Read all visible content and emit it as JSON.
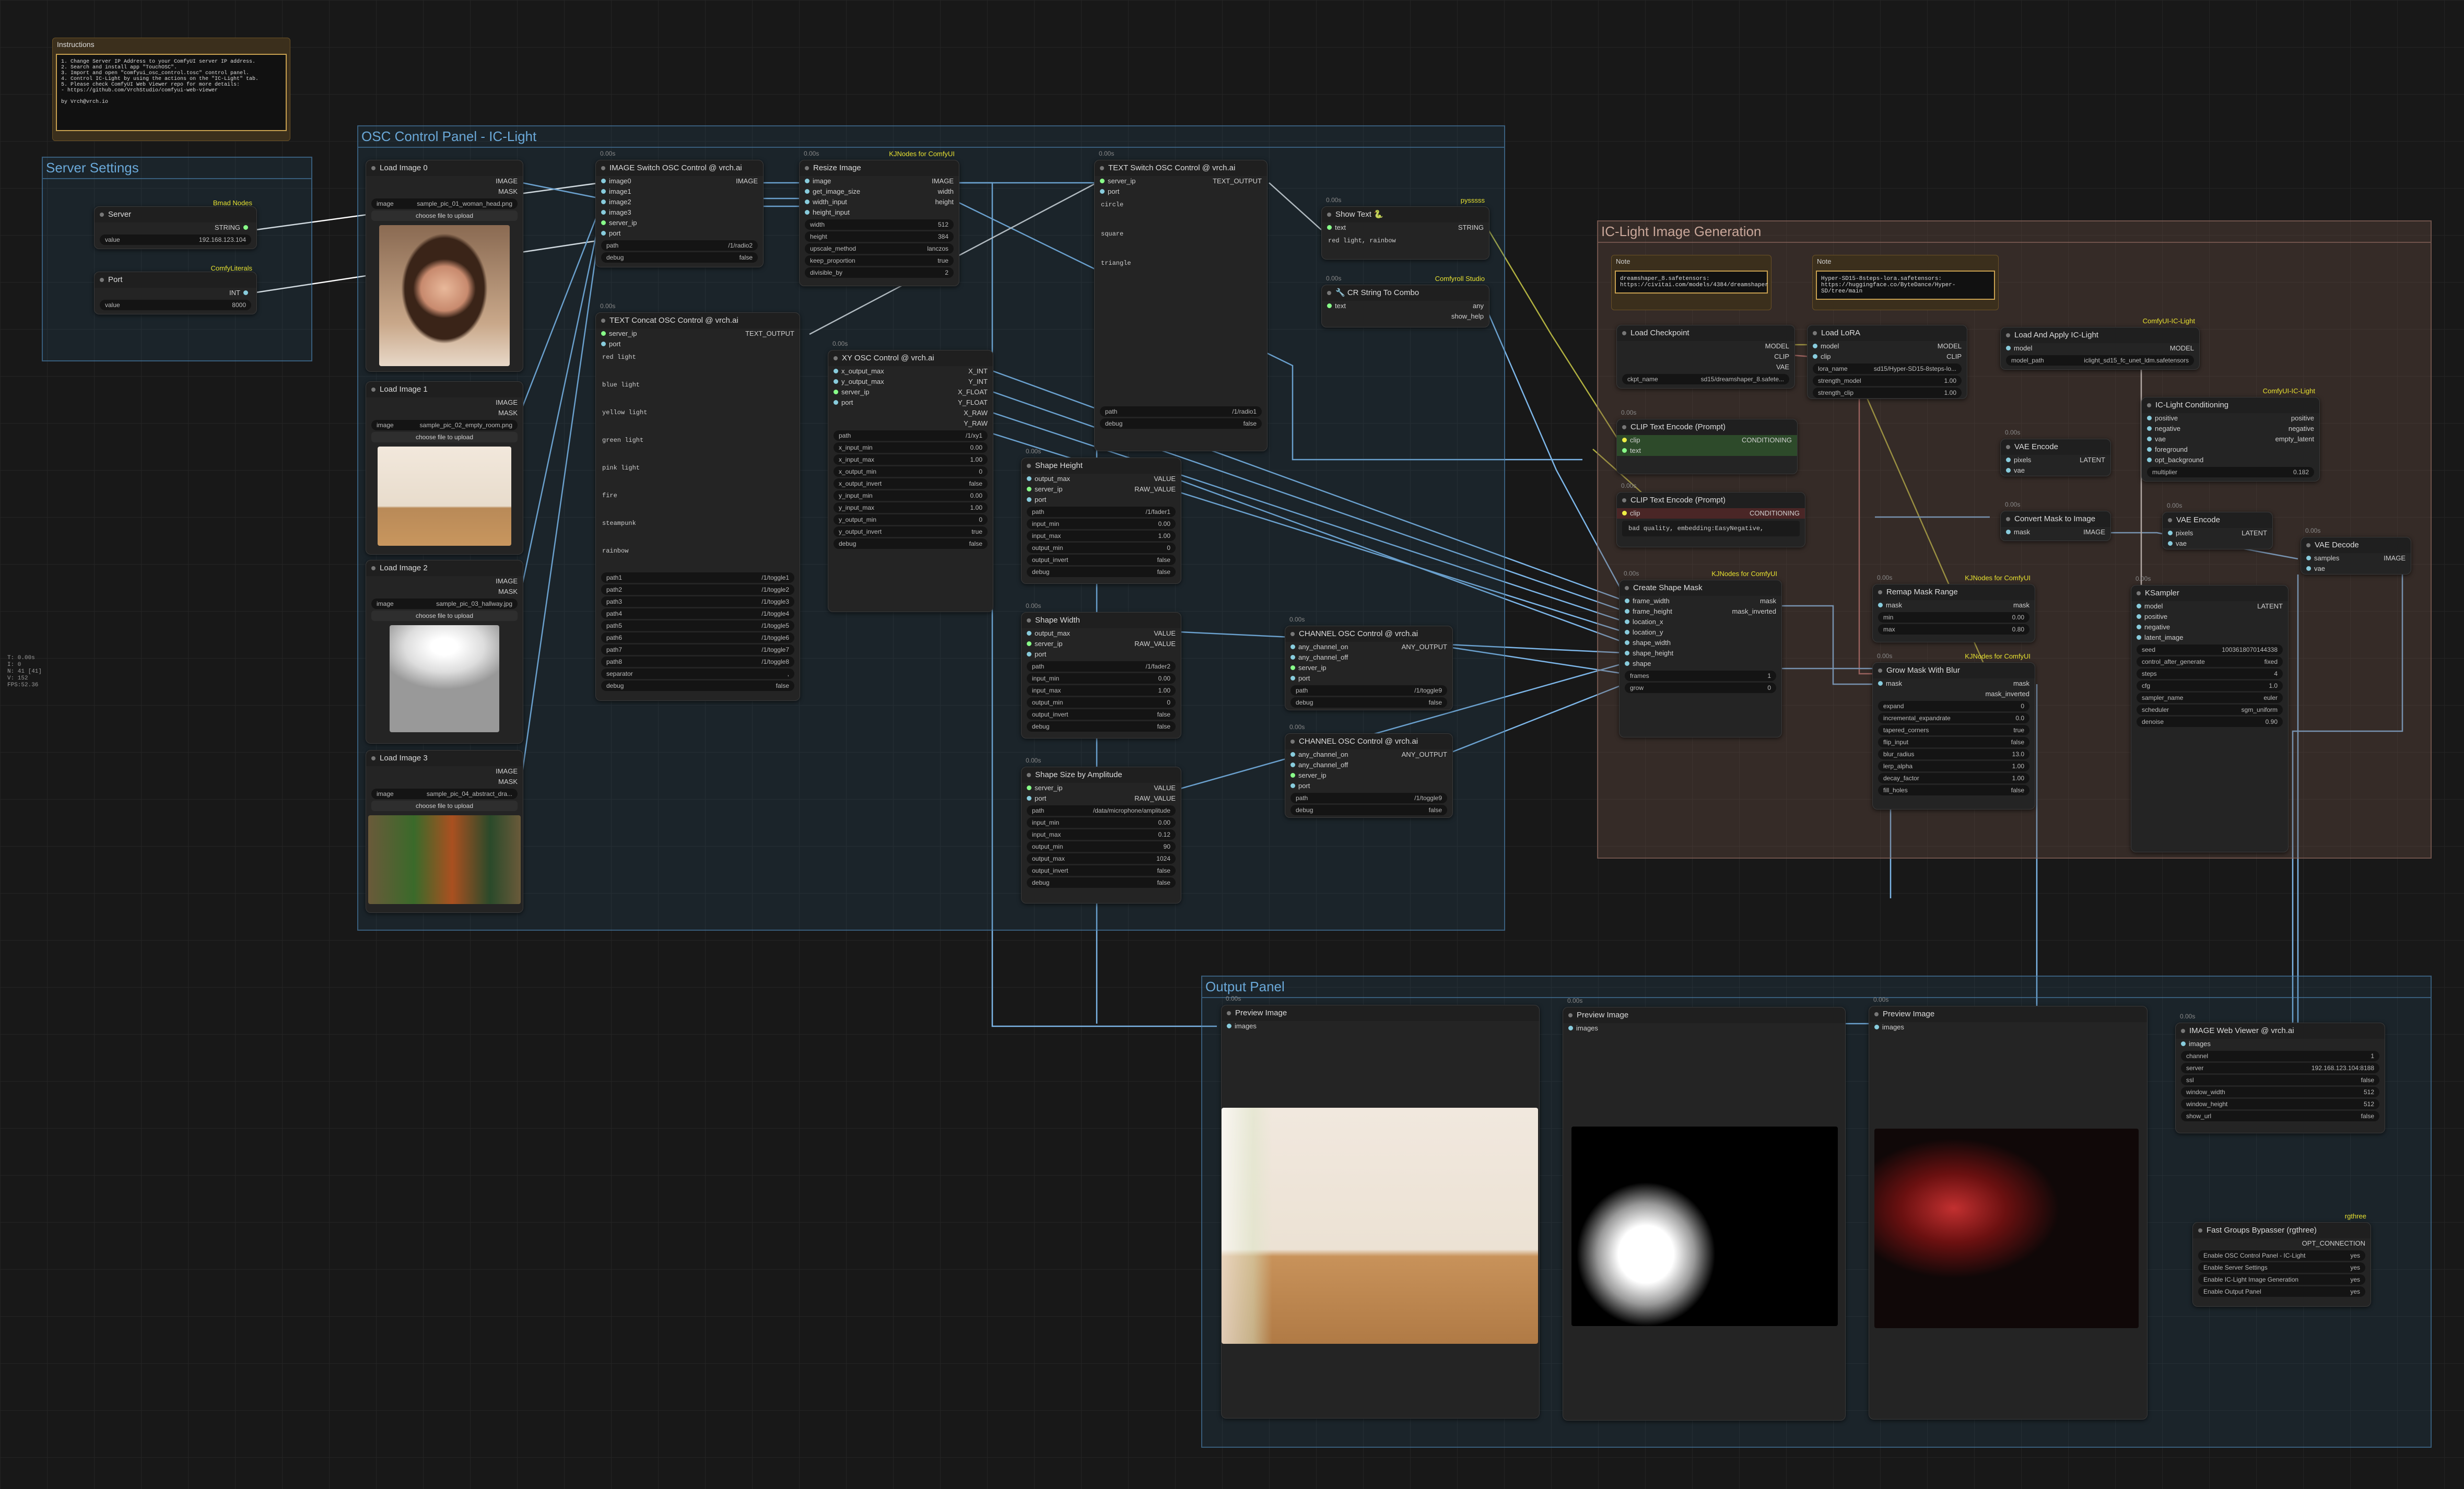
{
  "instructions": {
    "title": "Instructions",
    "body": "1. Change Server IP Address to your ComfyUI server IP address.\n2. Search and install app \"TouchOSC\".\n3. Import and open \"comfyui_osc_control.tosc\" control panel.\n4. Control IC-Light by using the actions on the \"IC-Light\" tab.\n5. Please check ComfyUI Web Viewer repo for more details:\n   - https://github.com/VrchStudio/comfyui-web-viewer\n\nby Vrch@vrch.io"
  },
  "groups": {
    "server": "Server Settings",
    "osc": "OSC Control Panel - IC-Light",
    "iclight": "IC-Light Image Generation",
    "output": "Output Panel"
  },
  "server_node": {
    "title": "Server",
    "tag": "Bmad Nodes",
    "out": "STRING",
    "value_label": "value",
    "value": "192.168.123.104"
  },
  "port_node": {
    "title": "Port",
    "tag": "ComfyLiterals",
    "out": "INT",
    "value_label": "value",
    "value": "8000"
  },
  "load_images": [
    {
      "title": "Load Image 0",
      "file": "sample_pic_01_woman_head.png"
    },
    {
      "title": "Load Image 1",
      "file": "sample_pic_02_empty_room.png"
    },
    {
      "title": "Load Image 2",
      "file": "sample_pic_03_hallway.jpg"
    },
    {
      "title": "Load Image 3",
      "file": "sample_pic_04_abstract_dra..."
    }
  ],
  "load_image_common": {
    "out1": "IMAGE",
    "out2": "MASK",
    "image_label": "image",
    "upload": "choose file to upload"
  },
  "image_switch": {
    "title": "IMAGE Switch OSC Control @ vrch.ai",
    "inputs": [
      "image0",
      "image1",
      "image2",
      "image3",
      "server_ip",
      "port"
    ],
    "out": "IMAGE",
    "path_label": "path",
    "path": "/1/radio2",
    "debug_label": "debug",
    "debug": "false"
  },
  "resize": {
    "title": "Resize Image",
    "tag": "KJNodes for ComfyUI",
    "inputs": [
      "image",
      "get_image_size",
      "width_input",
      "height_input"
    ],
    "outputs": [
      "IMAGE",
      "width",
      "height"
    ],
    "widgets": [
      [
        "width",
        "512"
      ],
      [
        "height",
        "384"
      ],
      [
        "upscale_method",
        "lanczos"
      ],
      [
        "keep_proportion",
        "true"
      ],
      [
        "divisible_by",
        "2"
      ]
    ]
  },
  "text_switch": {
    "title": "TEXT Switch OSC Control @ vrch.ai",
    "inputs": [
      "server_ip",
      "port"
    ],
    "out": "TEXT_OUTPUT",
    "options": [
      "circle",
      "square",
      "triangle"
    ],
    "path_label": "path",
    "path": "/1/radio1",
    "debug_label": "debug",
    "debug": "false"
  },
  "show_text": {
    "title": "Show Text 🐍",
    "tag": "pysssss",
    "in": "text",
    "out": "STRING",
    "value": "red light, rainbow"
  },
  "cr_combo": {
    "title": "🔧 CR String To Combo",
    "tag": "Comfyroll Studio",
    "in": "text",
    "outs": [
      "any",
      "show_help"
    ]
  },
  "text_concat": {
    "title": "TEXT Concat OSC Control @ vrch.ai",
    "inputs": [
      "server_ip",
      "port"
    ],
    "out": "TEXT_OUTPUT",
    "items": [
      "red light",
      "blue light",
      "yellow light",
      "green light",
      "pink light",
      "fire",
      "steampunk",
      "rainbow"
    ],
    "paths": [
      [
        "path1",
        "/1/toggle1"
      ],
      [
        "path2",
        "/1/toggle2"
      ],
      [
        "path3",
        "/1/toggle3"
      ],
      [
        "path4",
        "/1/toggle4"
      ],
      [
        "path5",
        "/1/toggle5"
      ],
      [
        "path6",
        "/1/toggle6"
      ],
      [
        "path7",
        "/1/toggle7"
      ],
      [
        "path8",
        "/1/toggle8"
      ],
      [
        "separator",
        ","
      ],
      [
        "debug",
        "false"
      ]
    ]
  },
  "xy_osc": {
    "title": "XY OSC Control @ vrch.ai",
    "inputs": [
      "x_output_max",
      "y_output_max",
      "server_ip",
      "port"
    ],
    "outputs": [
      "X_INT",
      "Y_INT",
      "X_FLOAT",
      "Y_FLOAT",
      "X_RAW",
      "Y_RAW"
    ],
    "widgets": [
      [
        "path",
        "/1/xy1"
      ],
      [
        "x_input_min",
        "0.00"
      ],
      [
        "x_input_max",
        "1.00"
      ],
      [
        "x_output_min",
        "0"
      ],
      [
        "x_output_invert",
        "false"
      ],
      [
        "y_input_min",
        "0.00"
      ],
      [
        "y_input_max",
        "1.00"
      ],
      [
        "y_output_min",
        "0"
      ],
      [
        "y_output_invert",
        "true"
      ],
      [
        "debug",
        "false"
      ]
    ]
  },
  "shape_height": {
    "title": "Shape Height",
    "inputs": [
      "output_max",
      "server_ip",
      "port"
    ],
    "outputs": [
      "VALUE",
      "RAW_VALUE"
    ],
    "widgets": [
      [
        "path",
        "/1/fader1"
      ],
      [
        "input_min",
        "0.00"
      ],
      [
        "input_max",
        "1.00"
      ],
      [
        "output_min",
        "0"
      ],
      [
        "output_invert",
        "false"
      ],
      [
        "debug",
        "false"
      ]
    ]
  },
  "shape_width": {
    "title": "Shape Width",
    "inputs": [
      "output_max",
      "server_ip",
      "port"
    ],
    "outputs": [
      "VALUE",
      "RAW_VALUE"
    ],
    "widgets": [
      [
        "path",
        "/1/fader2"
      ],
      [
        "input_min",
        "0.00"
      ],
      [
        "input_max",
        "1.00"
      ],
      [
        "output_min",
        "0"
      ],
      [
        "output_invert",
        "false"
      ],
      [
        "debug",
        "false"
      ]
    ]
  },
  "shape_amp": {
    "title": "Shape Size by Amplitude",
    "inputs": [
      "server_ip",
      "port"
    ],
    "outputs": [
      "VALUE",
      "RAW_VALUE"
    ],
    "widgets": [
      [
        "path",
        "/data/microphone/amplitude"
      ],
      [
        "input_min",
        "0.00"
      ],
      [
        "input_max",
        "0.12"
      ],
      [
        "output_min",
        "90"
      ],
      [
        "output_max",
        "1024"
      ],
      [
        "output_invert",
        "false"
      ],
      [
        "debug",
        "false"
      ]
    ]
  },
  "channel1": {
    "title": "CHANNEL OSC Control @ vrch.ai",
    "inputs": [
      "any_channel_on",
      "any_channel_off",
      "server_ip",
      "port"
    ],
    "out": "ANY_OUTPUT",
    "path": "/1/toggle9",
    "debug": "false"
  },
  "channel2": {
    "title": "CHANNEL OSC Control @ vrch.ai",
    "inputs": [
      "any_channel_on",
      "any_channel_off",
      "server_ip",
      "port"
    ],
    "out": "ANY_OUTPUT",
    "path": "/1/toggle9",
    "debug": "false"
  },
  "note1": {
    "title": "Note",
    "body": "dreamshaper_8.safetensors:\nhttps://civitai.com/models/4384/dreamshaper"
  },
  "note2": {
    "title": "Note",
    "body": "Hyper-SD15-8steps-lora.safetensors:\nhttps://huggingface.co/ByteDance/Hyper-SD/tree/main"
  },
  "checkpoint": {
    "title": "Load Checkpoint",
    "outputs": [
      "MODEL",
      "CLIP",
      "VAE"
    ],
    "ckpt_label": "ckpt_name",
    "ckpt": "sd15/dreamshaper_8.safete..."
  },
  "lora": {
    "title": "Load LoRA",
    "inputs": [
      "model",
      "clip"
    ],
    "outputs": [
      "MODEL",
      "CLIP"
    ],
    "widgets": [
      [
        "lora_name",
        "sd15/Hyper-SD15-8steps-lo..."
      ],
      [
        "strength_model",
        "1.00"
      ],
      [
        "strength_clip",
        "1.00"
      ]
    ]
  },
  "apply_iclight": {
    "title": "Load And Apply IC-Light",
    "tag": "ComfyUI-IC-Light",
    "in": "model",
    "out": "MODEL",
    "model_path_label": "model_path",
    "model_path": "iclight_sd15_fc_unet_ldm.safetensors"
  },
  "clip_pos": {
    "title": "CLIP Text Encode (Prompt)",
    "inputs": [
      "clip",
      "text"
    ],
    "out": "CONDITIONING"
  },
  "clip_neg": {
    "title": "CLIP Text Encode (Prompt)",
    "in": "clip",
    "out": "CONDITIONING",
    "text": "bad quality, embedding:EasyNegative,"
  },
  "vae_encode1": {
    "title": "VAE Encode",
    "inputs": [
      "pixels",
      "vae"
    ],
    "out": "LATENT"
  },
  "iclight_cond": {
    "title": "IC-Light Conditioning",
    "tag": "ComfyUI-IC-Light",
    "inputs": [
      "positive",
      "negative",
      "vae",
      "foreground",
      "opt_background"
    ],
    "outputs": [
      "positive",
      "negative",
      "empty_latent"
    ],
    "mult_label": "multiplier",
    "mult": "0.182"
  },
  "convert_mask": {
    "title": "Convert Mask to Image",
    "in": "mask",
    "out": "IMAGE"
  },
  "vae_encode2": {
    "title": "VAE Encode",
    "inputs": [
      "pixels",
      "vae"
    ],
    "out": "LATENT"
  },
  "vae_decode": {
    "title": "VAE Decode",
    "inputs": [
      "samples",
      "vae"
    ],
    "out": "IMAGE"
  },
  "create_mask": {
    "title": "Create Shape Mask",
    "tag": "KJNodes for ComfyUI",
    "inputs": [
      "frame_width",
      "frame_height",
      "location_x",
      "location_y",
      "shape_width",
      "shape_height",
      "shape"
    ],
    "outputs": [
      "mask",
      "mask_inverted"
    ],
    "widgets": [
      [
        "frames",
        "1"
      ],
      [
        "grow",
        "0"
      ]
    ]
  },
  "remap_mask": {
    "title": "Remap Mask Range",
    "tag": "KJNodes for ComfyUI",
    "in": "mask",
    "out": "mask",
    "widgets": [
      [
        "min",
        "0.00"
      ],
      [
        "max",
        "0.80"
      ]
    ]
  },
  "grow_mask": {
    "title": "Grow Mask With Blur",
    "tag": "KJNodes for ComfyUI",
    "in": "mask",
    "outputs": [
      "mask",
      "mask_inverted"
    ],
    "widgets": [
      [
        "expand",
        "0"
      ],
      [
        "incremental_expandrate",
        "0.0"
      ],
      [
        "tapered_corners",
        "true"
      ],
      [
        "flip_input",
        "false"
      ],
      [
        "blur_radius",
        "13.0"
      ],
      [
        "lerp_alpha",
        "1.00"
      ],
      [
        "decay_factor",
        "1.00"
      ],
      [
        "fill_holes",
        "false"
      ]
    ]
  },
  "ksampler": {
    "title": "KSampler",
    "inputs": [
      "model",
      "positive",
      "negative",
      "latent_image"
    ],
    "out": "LATENT",
    "widgets": [
      [
        "seed",
        "1003618070144338"
      ],
      [
        "control_after_generate",
        "fixed"
      ],
      [
        "steps",
        "4"
      ],
      [
        "cfg",
        "1.0"
      ],
      [
        "sampler_name",
        "euler"
      ],
      [
        "scheduler",
        "sgm_uniform"
      ],
      [
        "denoise",
        "0.90"
      ]
    ]
  },
  "preview1": {
    "title": "Preview Image",
    "in": "images"
  },
  "preview2": {
    "title": "Preview Image",
    "in": "images"
  },
  "preview3": {
    "title": "Preview Image",
    "in": "images"
  },
  "web_viewer": {
    "title": "IMAGE Web Viewer @ vrch.ai",
    "in": "images",
    "widgets": [
      [
        "channel",
        "1"
      ],
      [
        "server",
        "192.168.123.104:8188"
      ],
      [
        "ssl",
        "false"
      ],
      [
        "window_width",
        "512"
      ],
      [
        "window_height",
        "512"
      ],
      [
        "show_url",
        "false"
      ]
    ]
  },
  "bypasser": {
    "title": "Fast Groups Bypasser (rgthree)",
    "tag": "rgthree",
    "out": "OPT_CONNECTION",
    "items": [
      [
        "Enable OSC Control Panel - IC-Light",
        "yes"
      ],
      [
        "Enable Server Settings",
        "yes"
      ],
      [
        "Enable IC-Light Image Generation",
        "yes"
      ],
      [
        "Enable Output Panel",
        "yes"
      ]
    ]
  },
  "stats": [
    "T: 0.00s",
    "I: 0",
    "N: 41 [41]",
    "V: 152",
    "FPS:52.36"
  ],
  "colors": {
    "accent": "#6aa8d8",
    "warm": "#c9a79a",
    "tag": "#e6e030",
    "note_border": "#c8a050"
  }
}
